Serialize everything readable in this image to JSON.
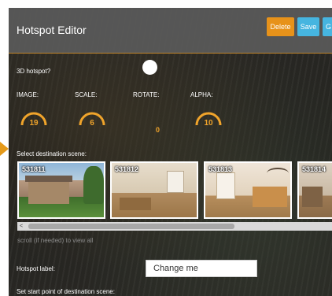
{
  "header": {
    "title": "Hotspot Editor",
    "delete_label": "Delete",
    "save_label": "Save",
    "go_label": "G"
  },
  "settings": {
    "hotspot_3d_label": "3D hotspot?",
    "image_label": "IMAGE:",
    "scale_label": "SCALE:",
    "rotate_label": "ROTATE:",
    "alpha_label": "ALPHA:",
    "image_value": "19",
    "scale_value": "6",
    "rotate_value": "0",
    "alpha_value": "10"
  },
  "scenes": {
    "heading": "Select destination scene:",
    "items": [
      {
        "id": "531811"
      },
      {
        "id": "531812"
      },
      {
        "id": "531813"
      },
      {
        "id": "531814"
      }
    ],
    "scroll_left_glyph": "<",
    "scroll_hint": "scroll (if needed) to view all"
  },
  "hotspot_label": {
    "label": "Hotspot label:",
    "value": "Change me"
  },
  "start_point": {
    "label": "Set start point of destination scene:"
  },
  "colors": {
    "accent_orange": "#e7921a",
    "accent_blue": "#46b5e0",
    "gauge_value": "#f0a42b"
  },
  "icons": {
    "toggle": "toggle-knob",
    "scroll_left": "chevron-left-icon"
  }
}
